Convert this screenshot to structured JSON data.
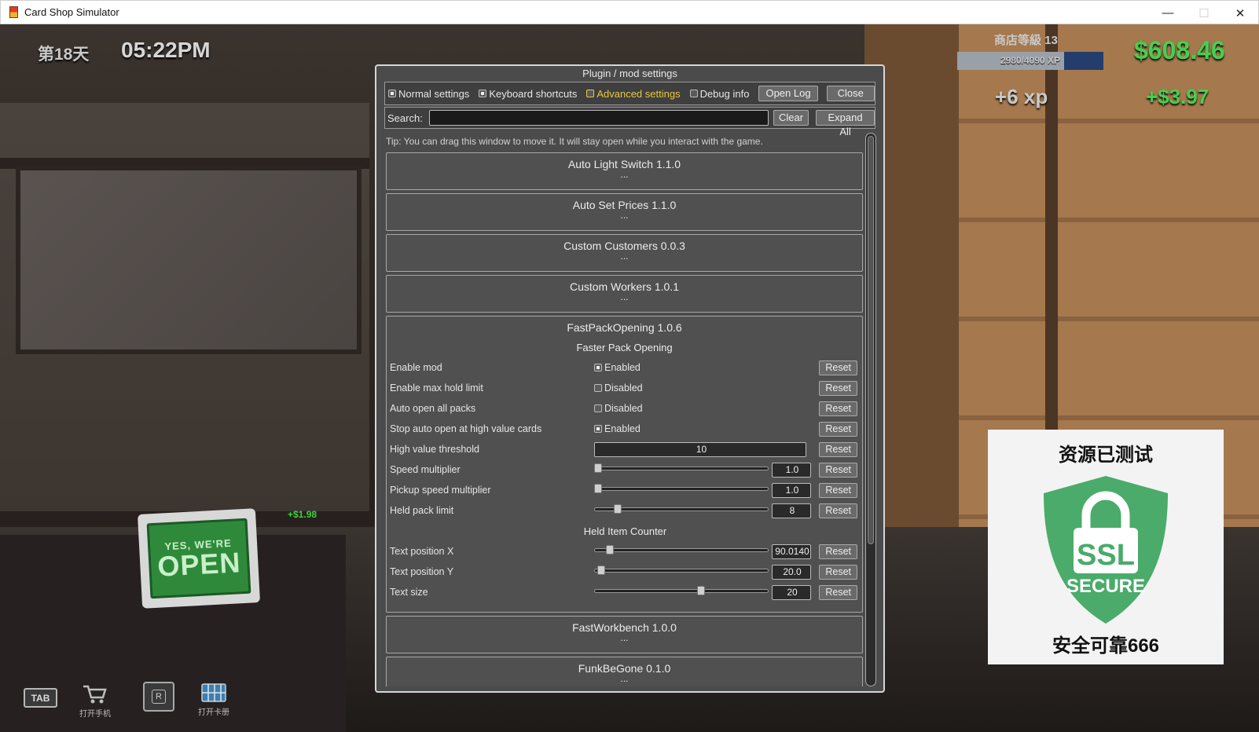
{
  "window": {
    "title": "Card Shop Simulator",
    "minimize": "—",
    "maximize": "☐",
    "close": "✕"
  },
  "hud": {
    "day": "第18天",
    "time": "05:22PM",
    "shop_level": "商店等級 13",
    "xp": "2980/4090 XP",
    "xp_progress": 0.7286,
    "money": "$608.46",
    "xp_gain": "+6 xp",
    "money_gain": "+$3.97",
    "floating_money": "+$1.98",
    "bottom": {
      "tab_key": "TAB",
      "phone_label": "打开手机",
      "r_key": "R",
      "album_label": "打开卡册"
    }
  },
  "scene": {
    "sign_small": "YES, WE'RE",
    "sign_big": "OPEN"
  },
  "ssl_badge": {
    "top_text": "资源已测试",
    "shield_line1": "SSL",
    "shield_line2": "SECURE",
    "bottom_text": "安全可靠666",
    "color": "#4aab6a"
  },
  "dialog": {
    "title": "Plugin / mod settings",
    "tabs": [
      {
        "label": "Normal settings",
        "selected": true
      },
      {
        "label": "Keyboard shortcuts",
        "selected": true
      },
      {
        "label": "Advanced settings",
        "selected": false
      },
      {
        "label": "Debug info",
        "selected": false
      }
    ],
    "open_log": "Open Log",
    "close": "Close",
    "search_label": "Search:",
    "search_value": "",
    "clear": "Clear",
    "expand_all": "Expand All",
    "tip": "Tip: You can drag this window to move it. It will stay open while you interact with the game.",
    "plugins_before": [
      {
        "name": "Auto Light Switch 1.1.0",
        "dots": "..."
      },
      {
        "name": "Auto Set Prices 1.1.0",
        "dots": "..."
      },
      {
        "name": "Custom Customers 0.0.3",
        "dots": "..."
      },
      {
        "name": "Custom Workers 1.0.1",
        "dots": "..."
      }
    ],
    "expanded_plugin": {
      "name": "FastPackOpening 1.0.6",
      "section1": "Faster Pack Opening",
      "section2": "Held Item Counter",
      "reset_label": "Reset",
      "settings": [
        {
          "label": "Enable mod",
          "value": "Enabled",
          "on": true
        },
        {
          "label": "Enable max hold limit",
          "value": "Disabled",
          "on": false
        },
        {
          "label": "Auto open all packs",
          "value": "Disabled",
          "on": false
        },
        {
          "label": "Stop auto open at high value cards",
          "value": "Enabled",
          "on": true
        },
        {
          "label": "High value threshold",
          "value": "10"
        },
        {
          "label": "Speed multiplier",
          "value": "1.0",
          "slider": 0.0
        },
        {
          "label": "Pickup speed multiplier",
          "value": "1.0",
          "slider": 0.0
        },
        {
          "label": "Held pack limit",
          "value": "8",
          "slider": 0.12
        },
        {
          "label": "Text position X",
          "value": "90.0140",
          "slider": 0.07
        },
        {
          "label": "Text position Y",
          "value": "20.0",
          "slider": 0.02
        },
        {
          "label": "Text size",
          "value": "20",
          "slider": 0.62
        }
      ]
    },
    "plugins_after": [
      {
        "name": "FastWorkbench 1.0.0",
        "dots": "..."
      },
      {
        "name": "FunkBeGone 0.1.0",
        "dots": "..."
      }
    ]
  }
}
